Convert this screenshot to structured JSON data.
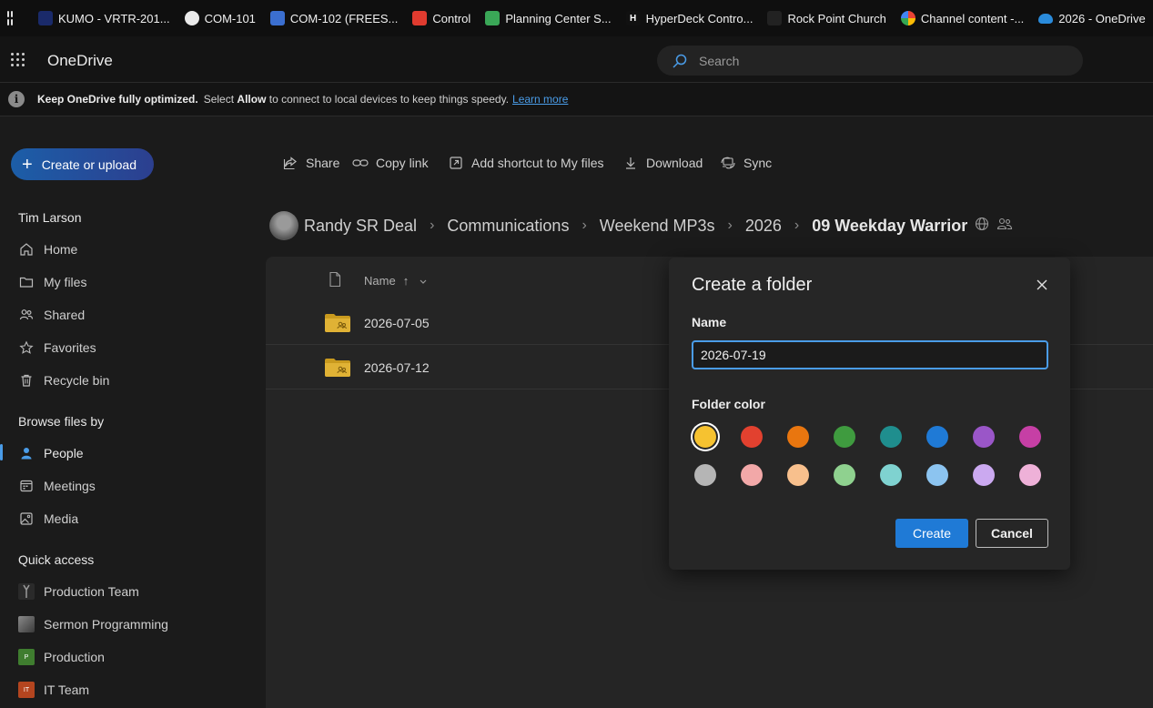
{
  "bookmarks": [
    {
      "label": "KUMO - VRTR-201...",
      "icon": "kumo-icon",
      "color": "#1a2a6a"
    },
    {
      "label": "COM-101",
      "icon": "globe-icon",
      "color": "#f0f0f0"
    },
    {
      "label": "COM-102 (FREES...",
      "icon": "gear-globe-icon",
      "color": "#3b6fd0"
    },
    {
      "label": "Control",
      "icon": "control-icon",
      "color": "#e03b2f"
    },
    {
      "label": "Planning Center S...",
      "icon": "planning-center-icon",
      "color": "#3aa757"
    },
    {
      "label": "HyperDeck Contro...",
      "icon": "hyperdeck-icon",
      "color": "#111111"
    },
    {
      "label": "Rock Point Church",
      "icon": "church-icon",
      "color": "#222222"
    },
    {
      "label": "Channel content -...",
      "icon": "google-icon",
      "color": "#ffffff"
    },
    {
      "label": "2026 - OneDrive",
      "icon": "onedrive-icon",
      "color": "#2a8bdb"
    }
  ],
  "app": {
    "name": "OneDrive",
    "search_placeholder": "Search"
  },
  "infobar": {
    "bold": "Keep OneDrive fully optimized.",
    "text1": "Select",
    "allow": "Allow",
    "text2": "to connect to local devices to keep things speedy.",
    "link": "Learn more"
  },
  "sidebar": {
    "create_label": "Create or upload",
    "user": "Tim Larson",
    "items": [
      {
        "label": "Home",
        "icon": "home-icon"
      },
      {
        "label": "My files",
        "icon": "folder-icon"
      },
      {
        "label": "Shared",
        "icon": "people-icon"
      },
      {
        "label": "Favorites",
        "icon": "star-icon"
      },
      {
        "label": "Recycle bin",
        "icon": "trash-icon"
      }
    ],
    "browse_head": "Browse files by",
    "browse": [
      {
        "label": "People",
        "icon": "person-icon"
      },
      {
        "label": "Meetings",
        "icon": "calendar-icon"
      },
      {
        "label": "Media",
        "icon": "image-icon"
      }
    ],
    "quick_head": "Quick access",
    "quick": [
      {
        "label": "Production Team",
        "color": "#2f2f2f"
      },
      {
        "label": "Sermon Programming",
        "color": "#6a6a6a"
      },
      {
        "label": "Production",
        "color": "#3f7d2f",
        "initial": "P"
      },
      {
        "label": "IT Team",
        "color": "#b4451f",
        "initial": "IT"
      }
    ]
  },
  "commands": {
    "share": "Share",
    "copy_link": "Copy link",
    "add_shortcut": "Add shortcut to My files",
    "download": "Download",
    "sync": "Sync"
  },
  "breadcrumb": [
    "Randy SR Deal",
    "Communications",
    "Weekend MP3s",
    "2026",
    "09 Weekday Warrior"
  ],
  "list": {
    "col_name": "Name",
    "sort_indicator": "↑",
    "rows": [
      "2026-07-05",
      "2026-07-12"
    ]
  },
  "dialog": {
    "title": "Create a folder",
    "name_label": "Name",
    "name_value": "2026-07-19",
    "color_label": "Folder color",
    "selected_color": "#f6c230",
    "colors_row1": [
      "#f6c230",
      "#e2412f",
      "#e9760f",
      "#3f9b3f",
      "#1f8e8e",
      "#1f7ad6",
      "#9a56c8",
      "#c63fa5"
    ],
    "colors_row2": [
      "#b5b5b5",
      "#f2a8a8",
      "#f8c08d",
      "#8fd18f",
      "#7fd2d0",
      "#8cc4f0",
      "#cba9f0",
      "#eeb1d8"
    ],
    "create_label": "Create",
    "cancel_label": "Cancel"
  }
}
